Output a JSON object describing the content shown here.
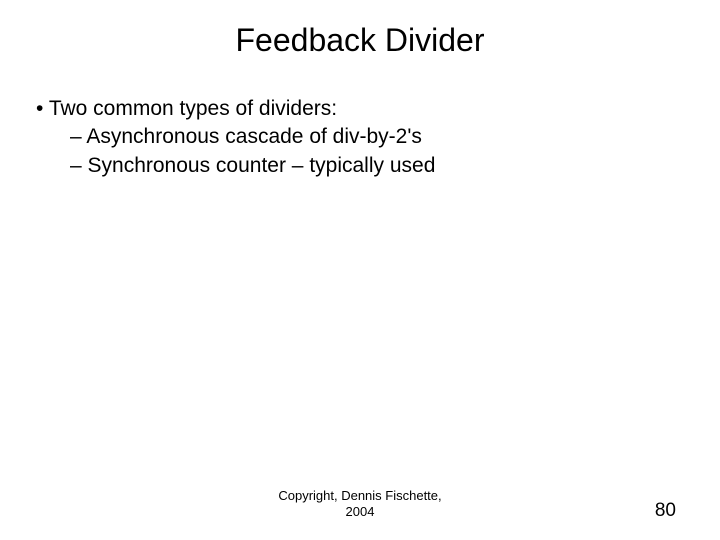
{
  "title": "Feedback Divider",
  "bullet": "Two common types of dividers:",
  "sub1": "Asynchronous cascade of div-by-2's",
  "sub2": "Synchronous counter – typically used",
  "copyright_line1": "Copyright, Dennis Fischette,",
  "copyright_line2": "2004",
  "page": "80"
}
